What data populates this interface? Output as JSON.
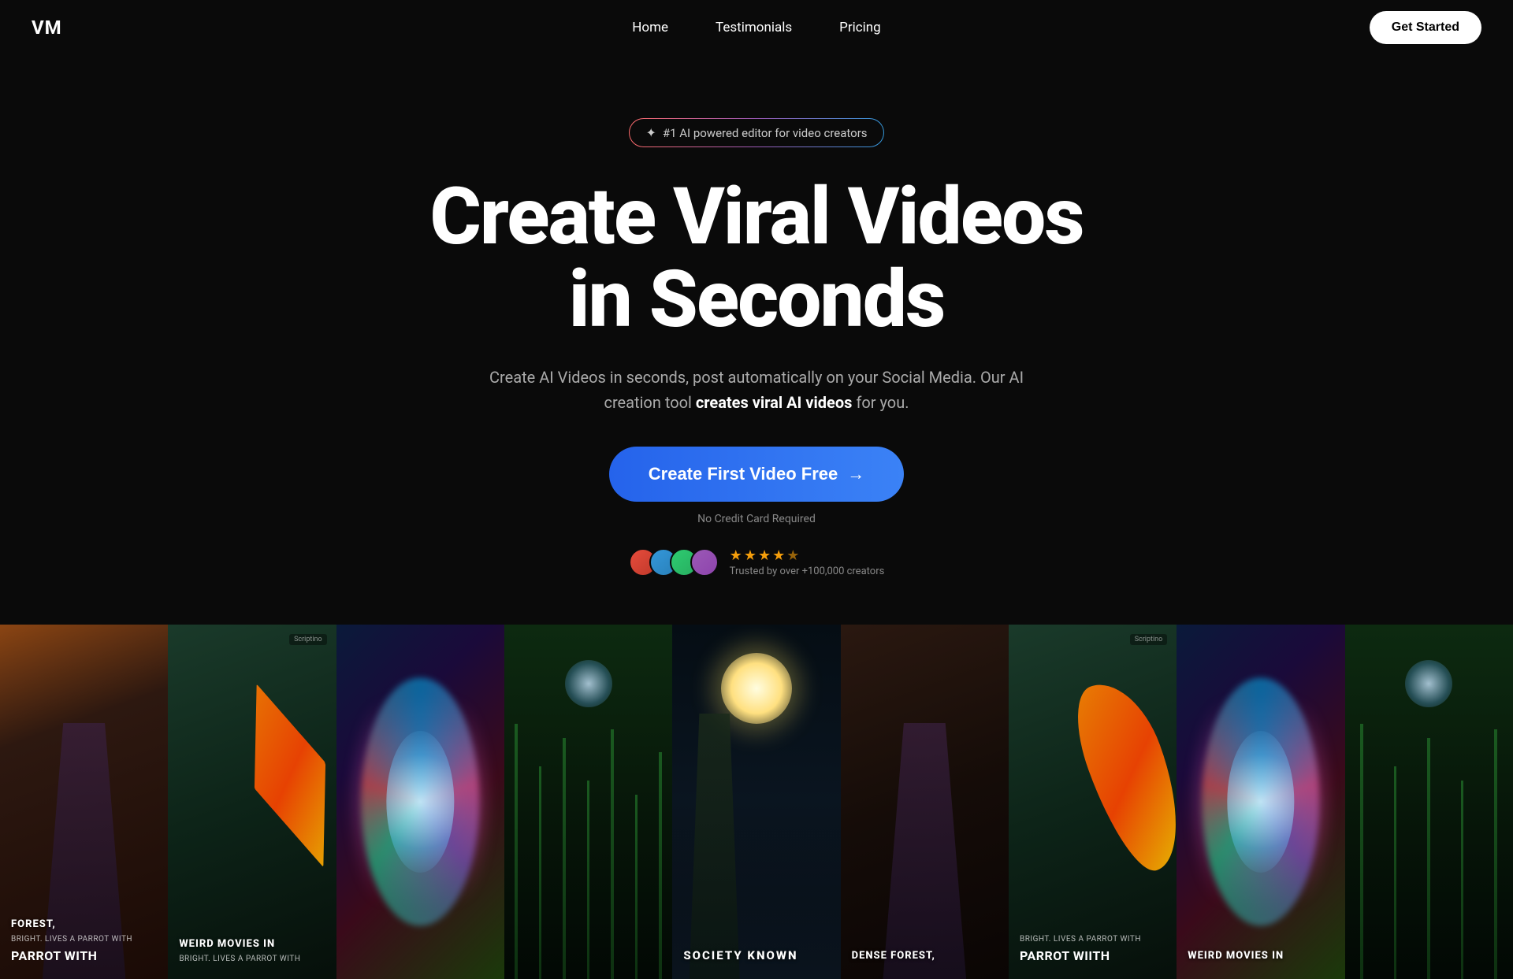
{
  "logo": {
    "text": "VM"
  },
  "nav": {
    "links": [
      {
        "id": "home",
        "label": "Home"
      },
      {
        "id": "testimonials",
        "label": "Testimonials"
      },
      {
        "id": "pricing",
        "label": "Pricing"
      }
    ],
    "cta": "Get Started"
  },
  "hero": {
    "badge": "#1 AI powered editor for video creators",
    "badge_icon": "✦",
    "title_line1": "Create Viral Videos",
    "title_line2": "in Seconds",
    "subtitle_plain1": "Create AI Videos in seconds, post automatically on your Social Media. Our AI creation tool ",
    "subtitle_bold": "creates viral AI videos",
    "subtitle_plain2": " for you.",
    "cta_label": "Create First Video Free",
    "cta_arrow": "→",
    "no_cc": "No Credit Card Required",
    "trust_text": "Trusted by over +100,000 creators",
    "stars": [
      "★",
      "★",
      "★",
      "★",
      "½"
    ]
  },
  "video_cards": [
    {
      "id": "vc1",
      "type": "person",
      "title": "FOREST,",
      "subtitle": "BRIGHT. LIVES A PARROT WITH",
      "bottom_text": "PaRROT With",
      "has_swirl": false,
      "has_bird": false,
      "has_moon": false
    },
    {
      "id": "vc2",
      "type": "bird",
      "title": "WEIRD MOVIES IN",
      "subtitle": "BRIGHT. LIVES A PARROT WITH",
      "bottom_text": "",
      "has_swirl": false,
      "has_bird": true,
      "has_moon": false,
      "watermark": "Scriptino"
    },
    {
      "id": "vc3",
      "type": "swirl",
      "title": "",
      "subtitle": "",
      "bottom_text": "",
      "has_swirl": true,
      "has_bird": false,
      "has_moon": false
    },
    {
      "id": "vc4",
      "type": "forest",
      "title": "",
      "subtitle": "",
      "bottom_text": "",
      "has_swirl": false,
      "has_bird": false,
      "has_moon": false
    },
    {
      "id": "vc5",
      "type": "moon",
      "title": "SOCIETY KNOWN",
      "subtitle": "",
      "bottom_text": "",
      "has_swirl": false,
      "has_bird": false,
      "has_moon": true
    },
    {
      "id": "vc6",
      "type": "person",
      "title": "DENSE FOREST,",
      "subtitle": "",
      "bottom_text": "",
      "has_swirl": false,
      "has_bird": false,
      "has_moon": false
    },
    {
      "id": "vc7",
      "type": "bird",
      "title": "",
      "subtitle": "BRIGHT. LIVES A PARROT WITH",
      "bottom_text": "PaRROT Wiith",
      "has_swirl": false,
      "has_bird": true,
      "has_moon": false,
      "watermark": "Scriptino"
    },
    {
      "id": "vc8",
      "type": "swirl",
      "title": "WEIRD MOVIES IN",
      "subtitle": "",
      "bottom_text": "",
      "has_swirl": true,
      "has_bird": false,
      "has_moon": false
    },
    {
      "id": "vc9",
      "type": "forest",
      "title": "",
      "subtitle": "",
      "bottom_text": "",
      "has_swirl": false,
      "has_bird": false,
      "has_moon": false
    }
  ]
}
